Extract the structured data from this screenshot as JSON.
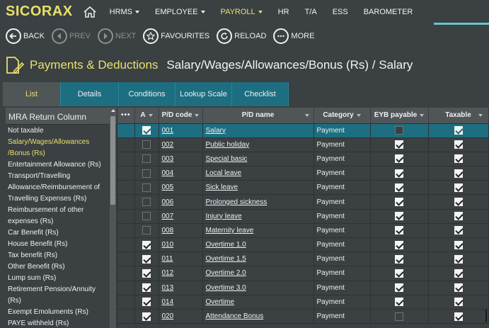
{
  "app": {
    "logo": "SICORAX"
  },
  "nav": {
    "items": [
      {
        "label": "HRMS",
        "dropdown": true,
        "active": false
      },
      {
        "label": "EMPLOYEE",
        "dropdown": true,
        "active": false
      },
      {
        "label": "PAYROLL",
        "dropdown": true,
        "active": true
      },
      {
        "label": "HR",
        "dropdown": false,
        "active": false
      },
      {
        "label": "T/A",
        "dropdown": false,
        "active": false
      },
      {
        "label": "ESS",
        "dropdown": false,
        "active": false
      },
      {
        "label": "BAROMETER",
        "dropdown": false,
        "active": false
      }
    ]
  },
  "toolbar": {
    "back": "BACK",
    "prev": "PREV",
    "next": "NEXT",
    "favourites": "FAVOURITES",
    "reload": "RELOAD",
    "more": "MORE"
  },
  "title": {
    "main": "Payments & Deductions",
    "path": "Salary/Wages/Allowances/Bonus (Rs) /   Salary"
  },
  "tabs": [
    "List",
    "Details",
    "Conditions",
    "Lookup Scale",
    "Checklist"
  ],
  "active_tab": "List",
  "left_panel": {
    "header": "MRA Return Column",
    "items": [
      "Not taxable",
      "Salary/Wages/Allowances /Bonus (Rs)",
      "Entertainment Allowance (Rs)",
      "Transport/Travelling Allowance/Reimbursement of Travelling Expenses (Rs)",
      "Reimbursement of other expenses (Rs)",
      "Car Benefit (Rs)",
      "House Benefit (Rs)",
      "Tax benefit (Rs)",
      "Other Benefit (Rs)",
      "Lump sum (Rs)",
      "Retirement Pension/Annuity (Rs)",
      "Exempt Emoluments (Rs)",
      "PAYE withheld (Rs)"
    ],
    "selected_index": 1
  },
  "grid": {
    "columns": {
      "menu": "•••",
      "a": "A",
      "code": "P/D code",
      "name": "P/D name",
      "category": "Category",
      "eyb": "EYB payable",
      "taxable": "Taxable"
    },
    "rows": [
      {
        "a": true,
        "code": "001",
        "name": "Salary",
        "category": "Payment",
        "eyb": false,
        "taxable": true
      },
      {
        "a": false,
        "code": "002",
        "name": "Public holiday",
        "category": "Payment",
        "eyb": true,
        "taxable": true
      },
      {
        "a": false,
        "code": "003",
        "name": "Special basic",
        "category": "Payment",
        "eyb": true,
        "taxable": true
      },
      {
        "a": false,
        "code": "004",
        "name": "Local leave",
        "category": "Payment",
        "eyb": true,
        "taxable": true
      },
      {
        "a": false,
        "code": "005",
        "name": "Sick leave",
        "category": "Payment",
        "eyb": true,
        "taxable": true
      },
      {
        "a": false,
        "code": "006",
        "name": "Prolonged sickness",
        "category": "Payment",
        "eyb": true,
        "taxable": true
      },
      {
        "a": false,
        "code": "007",
        "name": "Injury leave",
        "category": "Payment",
        "eyb": true,
        "taxable": true
      },
      {
        "a": false,
        "code": "008",
        "name": "Maternity leave",
        "category": "Payment",
        "eyb": true,
        "taxable": true
      },
      {
        "a": true,
        "code": "010",
        "name": "Overtime 1.0",
        "category": "Payment",
        "eyb": true,
        "taxable": true
      },
      {
        "a": true,
        "code": "011",
        "name": "Overtime 1.5",
        "category": "Payment",
        "eyb": true,
        "taxable": true
      },
      {
        "a": true,
        "code": "012",
        "name": "Overtime 2.0",
        "category": "Payment",
        "eyb": true,
        "taxable": true
      },
      {
        "a": true,
        "code": "013",
        "name": "Overtime 3.0",
        "category": "Payment",
        "eyb": true,
        "taxable": true
      },
      {
        "a": true,
        "code": "014",
        "name": "Overtime",
        "category": "Payment",
        "eyb": true,
        "taxable": true
      },
      {
        "a": true,
        "code": "020",
        "name": "Attendance Bonus",
        "category": "Payment",
        "eyb": false,
        "taxable": true
      }
    ],
    "selected_row": 0
  },
  "colors": {
    "background": "#3b4043",
    "accent_yellow": "#e8e06a",
    "teal": "#1d6e80",
    "header_gray": "#505558"
  }
}
